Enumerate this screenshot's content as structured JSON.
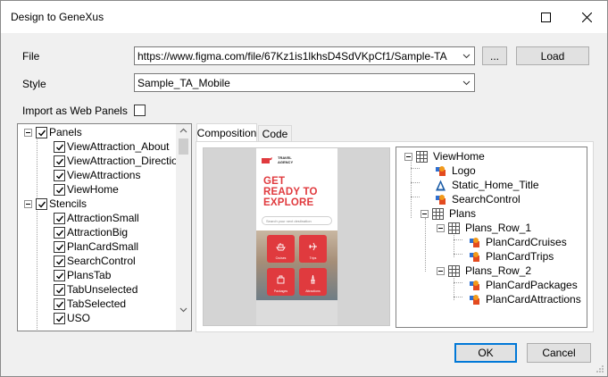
{
  "window": {
    "title": "Design to GeneXus"
  },
  "form": {
    "file_label": "File",
    "file_value": "https://www.figma.com/file/67Kz1is1lkhsD4SdVKpCf1/Sample-TA",
    "browse_label": "...",
    "load_label": "Load",
    "style_label": "Style",
    "style_value": "Sample_TA_Mobile",
    "import_label": "Import as Web Panels",
    "import_checked": false
  },
  "left_tree": {
    "groups": [
      {
        "label": "Panels",
        "items": [
          "ViewAttraction_About",
          "ViewAttraction_Directions",
          "ViewAttractions",
          "ViewHome"
        ]
      },
      {
        "label": "Stencils",
        "items": [
          "AttractionSmall",
          "AttractionBig",
          "PlanCardSmall",
          "SearchControl",
          "PlansTab",
          "TabUnselected",
          "TabSelected",
          "USO"
        ]
      }
    ]
  },
  "tabs": [
    {
      "label": "Composition",
      "active": true
    },
    {
      "label": "Code",
      "active": false
    }
  ],
  "preview": {
    "brand": "TRAVEL AGENCY",
    "headline": [
      "GET",
      "READY TO",
      "EXPLORE"
    ],
    "search_placeholder": "Search your next destination",
    "tiles": [
      "Cruises",
      "Trips",
      "Packages",
      "Attractions"
    ],
    "accent": "#e03a3e"
  },
  "right_tree": {
    "root": "ViewHome",
    "nodes": [
      {
        "label": "Logo",
        "icon": "stencil-icon",
        "depth": 1
      },
      {
        "label": "Static_Home_Title",
        "icon": "text-icon",
        "depth": 1
      },
      {
        "label": "SearchControl",
        "icon": "stencil-icon",
        "depth": 1
      },
      {
        "label": "Plans",
        "icon": "table-icon",
        "depth": 1,
        "expanded": true
      },
      {
        "label": "Plans_Row_1",
        "icon": "table-icon",
        "depth": 2,
        "expanded": true
      },
      {
        "label": "PlanCardCruises",
        "icon": "stencil-icon",
        "depth": 3
      },
      {
        "label": "PlanCardTrips",
        "icon": "stencil-icon",
        "depth": 3
      },
      {
        "label": "Plans_Row_2",
        "icon": "table-icon",
        "depth": 2,
        "expanded": true
      },
      {
        "label": "PlanCardPackages",
        "icon": "stencil-icon",
        "depth": 3
      },
      {
        "label": "PlanCardAttractions",
        "icon": "stencil-icon",
        "depth": 3
      }
    ]
  },
  "footer": {
    "ok_label": "OK",
    "cancel_label": "Cancel"
  }
}
